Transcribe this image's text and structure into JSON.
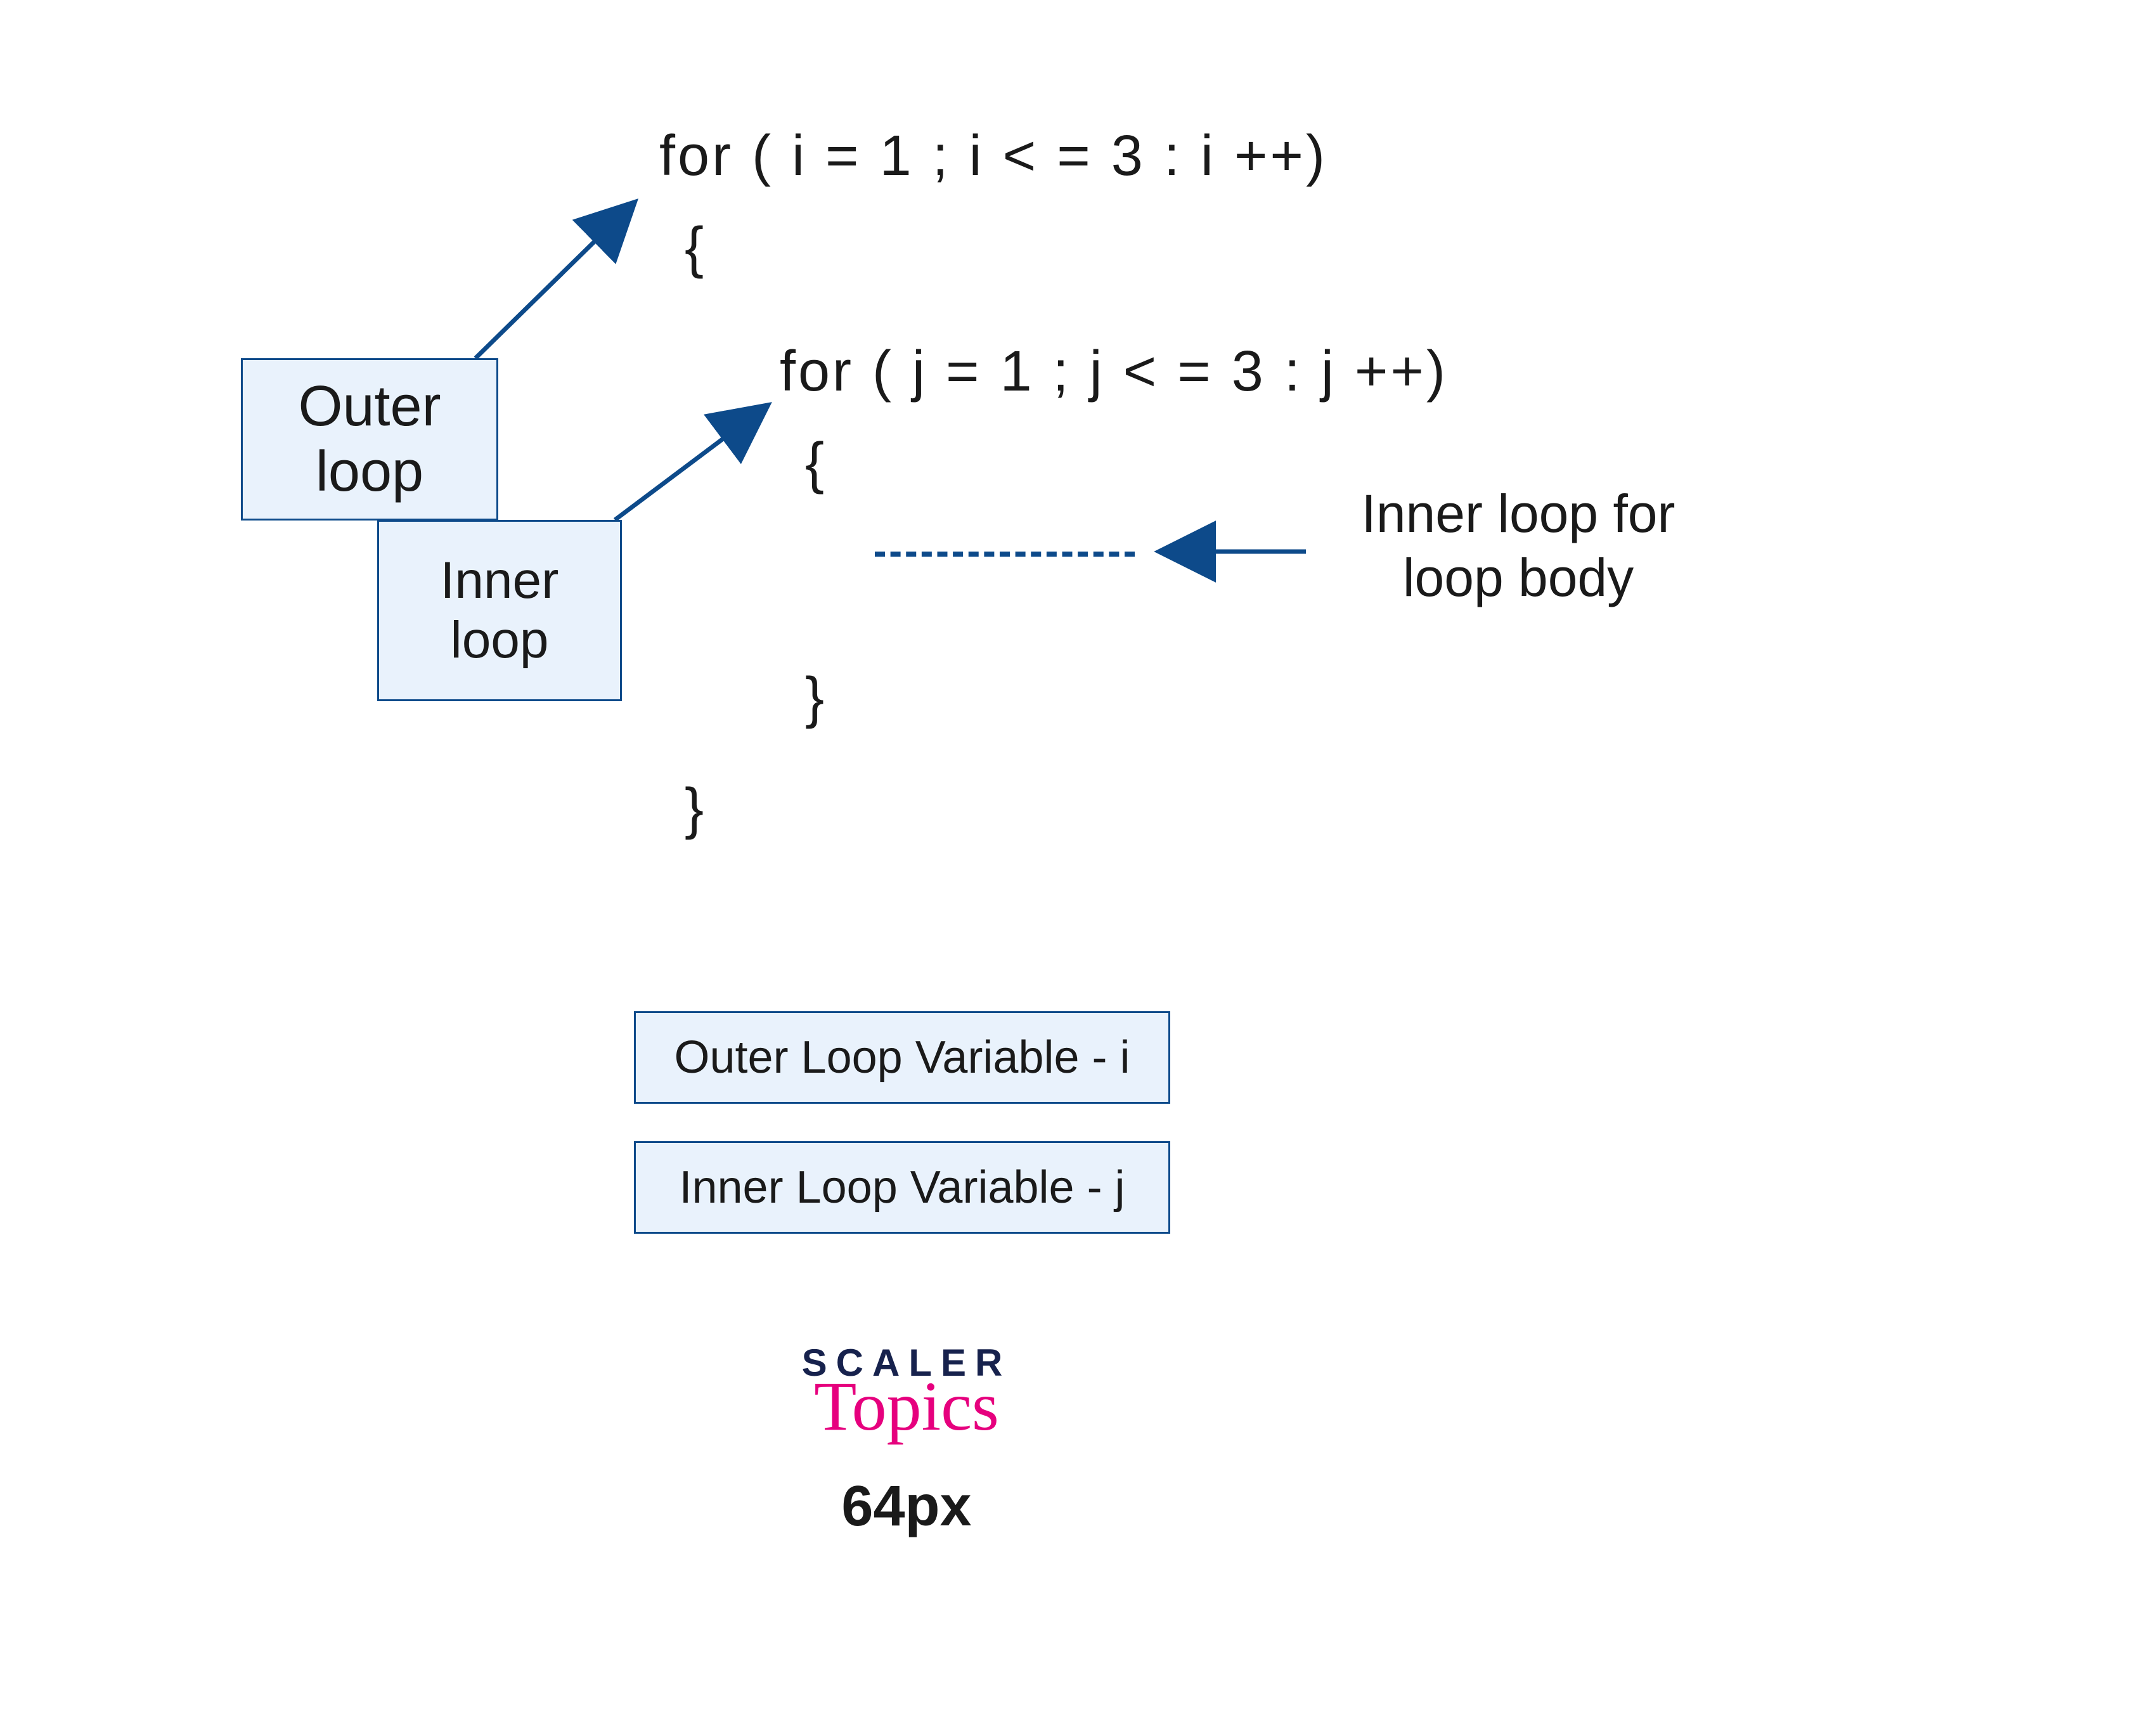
{
  "code": {
    "outer_for": "for ( i = 1 ; i < = 3 : i ++)",
    "outer_open_brace": "{",
    "inner_for": "for ( j = 1 ; j < = 3 : j ++)",
    "inner_open_brace": "{",
    "inner_close_brace": "}",
    "outer_close_brace": "}"
  },
  "labels": {
    "outer_l1": "Outer",
    "outer_l2": "loop",
    "inner_l1": "Inner",
    "inner_l2": "loop"
  },
  "annotation": {
    "l1": "Inner loop for",
    "l2": "loop body"
  },
  "legend": {
    "outer_var": "Outer Loop Variable - i",
    "inner_var": "Inner Loop Variable - j"
  },
  "logo": {
    "brand": "SCALER",
    "sub": "Topics"
  },
  "footer": {
    "size": "64px"
  },
  "colors": {
    "arrow": "#0d4a8a",
    "box_fill": "#e9f2fc",
    "box_border": "#0d4a8a"
  }
}
